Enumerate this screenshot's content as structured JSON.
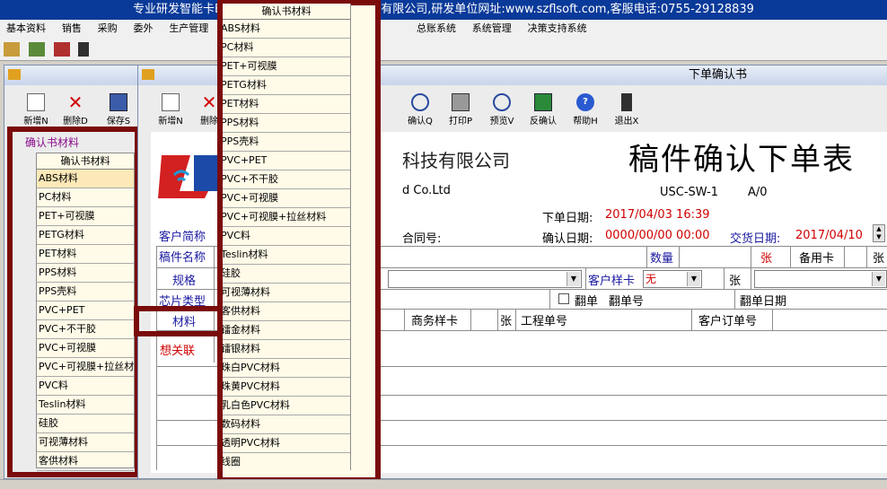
{
  "app": {
    "title": "专业研发智能卡ERP系统,由深圳市飞龙软件科技有限公司,研发单位网址:www.szflsoft.com,客服电话:0755-29128839"
  },
  "menu": [
    "基本资料",
    "销售",
    "采购",
    "委外",
    "生产管理",
    "",
    "",
    "",
    "总账系统",
    "系统管理",
    "决策支持系统"
  ],
  "left_window": {
    "toolbar": {
      "new": "新增N",
      "delete": "删除D",
      "save": "保存S"
    },
    "group_title": "确认书材料",
    "list_header": "确认书材料",
    "items": [
      "ABS材料",
      "PC材料",
      "PET+可视膜",
      "PETG材料",
      "PET材料",
      "PPS材料",
      "PPS壳料",
      "PVC+PET",
      "PVC+不干胶",
      "PVC+可视膜",
      "PVC+可视膜+拉丝材料",
      "PVC料",
      "Teslin材料",
      "硅胶",
      "可视薄材料",
      "客供材料"
    ]
  },
  "dropdown": {
    "header": "确认书材料",
    "items": [
      "ABS材料",
      "PC材料",
      "PET+可视膜",
      "PETG材料",
      "PET材料",
      "PPS材料",
      "PPS壳料",
      "PVC+PET",
      "PVC+不干胶",
      "PVC+可视膜",
      "PVC+可视膜+拉丝材料",
      "PVC料",
      "Teslin材料",
      "硅胶",
      "可视薄材料",
      "客供材料",
      "镭金材料",
      "镭银材料",
      "珠白PVC材料",
      "珠黄PVC材料",
      "乳白色PVC材料",
      "数码材料",
      "透明PVC材料",
      "线圈"
    ]
  },
  "main_window": {
    "title": "下单确认书",
    "toolbar": {
      "new": "新增N",
      "delete": "删除",
      "confirm": "确认Q",
      "print": "打印P",
      "preview": "预览V",
      "unconfirm": "反确认",
      "help": "帮助H",
      "exit": "退出X"
    },
    "company_cn_tail": "科技有限公司",
    "company_en_tail": "d Co.Ltd",
    "form_title": "稿件确认下单表",
    "doc_code": "USC-SW-1",
    "doc_version": "A/0",
    "order_date_label": "下单日期:",
    "order_date": "2017/04/03 16:39",
    "contract_label": "合同号:",
    "confirm_date_label": "确认日期:",
    "confirm_date": "0000/00/00 00:00",
    "delivery_label": "交货日期:",
    "delivery_date": "2017/04/10",
    "labels": {
      "customer": "客户简称",
      "artwork": "稿件名称",
      "spec": "规格",
      "chip": "芯片类型",
      "material": "材料",
      "association": "想关联",
      "quantity": "数量",
      "sheet": "张",
      "spare_card": "备用卡",
      "sheet2": "张",
      "customer_sample": "客户样卡",
      "customer_sample_value": "无",
      "sheet3": "张",
      "flip": "翻单",
      "flip_no": "翻单号",
      "flip_date": "翻单日期",
      "biz_sample": "商务样卡",
      "sheet4": "张",
      "work_order": "工程单号",
      "customer_order": "客户订单号"
    }
  }
}
